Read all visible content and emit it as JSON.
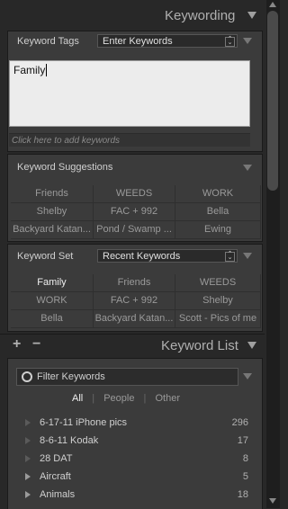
{
  "keywording": {
    "header_title": "Keywording",
    "keyword_tags_label": "Keyword Tags",
    "keyword_tags_mode": "Enter Keywords",
    "keywords_text": "Family",
    "add_hint": "Click here to add keywords",
    "suggestions_title": "Keyword Suggestions",
    "suggestions": [
      "Friends",
      "WEEDS",
      "WORK",
      "Shelby",
      "FAC + 992",
      "Bella",
      "Backyard Katan...",
      "Pond / Swamp ...",
      "Ewing"
    ],
    "keyword_set_label": "Keyword Set",
    "keyword_set_value": "Recent Keywords",
    "set_keywords": [
      "Family",
      "Friends",
      "WEEDS",
      "WORK",
      "FAC + 992",
      "Shelby",
      "Bella",
      "Backyard Katan...",
      "Scott - Pics of me"
    ]
  },
  "keyword_list": {
    "header_title": "Keyword List",
    "add_symbol": "+",
    "remove_symbol": "−",
    "filter_placeholder": "Filter Keywords",
    "filter_tabs": [
      "All",
      "People",
      "Other"
    ],
    "tab_separator": "|",
    "items": [
      {
        "name": "6-17-11 iPhone pics",
        "count": "296"
      },
      {
        "name": "8-6-11 Kodak",
        "count": "17"
      },
      {
        "name": "28 DAT",
        "count": "8"
      },
      {
        "name": "Aircraft",
        "count": "5"
      },
      {
        "name": "Animals",
        "count": "18"
      }
    ]
  },
  "colors": {
    "panel_bg": "#282828",
    "section_bg": "#3b3b3b",
    "text": "#c8c8c8",
    "active_text": "#f0f0f0",
    "input_bg": "#ececec"
  }
}
